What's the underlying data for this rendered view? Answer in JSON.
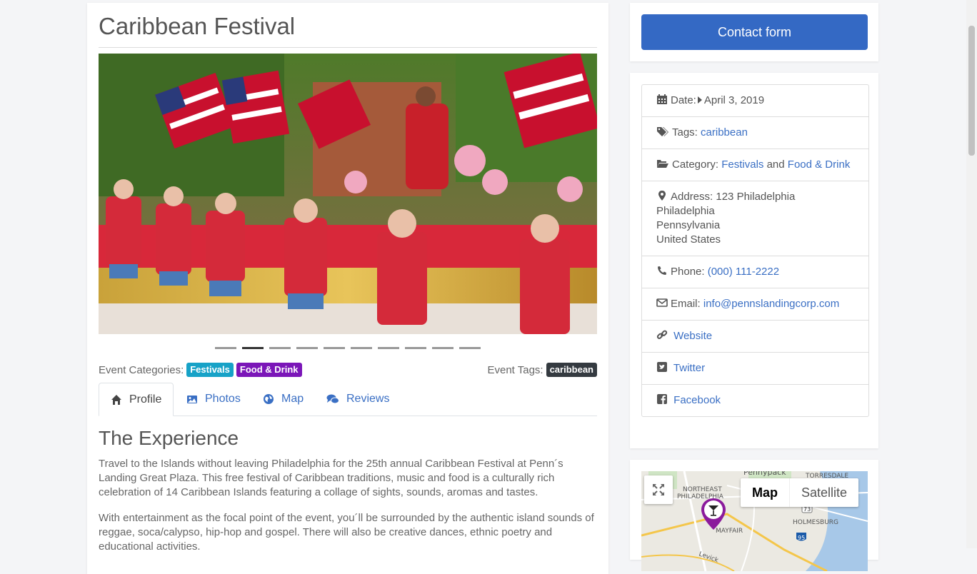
{
  "page": {
    "title": "Caribbean Festival"
  },
  "carousel": {
    "slide_count": 10,
    "active_index": 1
  },
  "meta": {
    "categories_label": "Event Categories:",
    "categories": [
      {
        "label": "Festivals",
        "color": "#17a2c7"
      },
      {
        "label": "Food & Drink",
        "color": "#7b16b8"
      }
    ],
    "tags_label": "Event Tags:",
    "tags": [
      {
        "label": "caribbean",
        "color": "#343a40"
      }
    ]
  },
  "tabs": [
    {
      "label": "Profile",
      "icon": "home-icon",
      "active": true
    },
    {
      "label": "Photos",
      "icon": "image-icon",
      "active": false
    },
    {
      "label": "Map",
      "icon": "globe-icon",
      "active": false
    },
    {
      "label": "Reviews",
      "icon": "comments-icon",
      "active": false
    }
  ],
  "content": {
    "heading": "The Experience",
    "paragraph1": "Travel to the Islands without leaving Philadelphia for the 25th annual Caribbean Festival at Penn´s Landing Great Plaza. This free festival of Caribbean traditions, music and food is a culturally rich celebration of 14 Caribbean Islands featuring a collage of sights, sounds, aromas and tastes.",
    "paragraph2": "With entertainment as the focal point of the event, you´ll be surrounded by the authentic island sounds of reggae, soca/calypso, hip-hop and gospel. There will also be creative dances, ethnic poetry and educational activities."
  },
  "sidebar": {
    "contact_button": "Contact form",
    "date_label": "Date:",
    "date_value": "April 3, 2019",
    "tags_label": "Tags:",
    "tags_value": "caribbean",
    "category_label": "Category:",
    "category_1": "Festivals",
    "category_and": "and",
    "category_2": "Food & Drink",
    "address_label": "Address:",
    "address_line1": "123 Philadelphia",
    "address_line2": "Philadelphia",
    "address_line3": "Pennsylvania",
    "address_line4": "United States",
    "phone_label": "Phone:",
    "phone_value": "(000) 111-2222",
    "email_label": "Email:",
    "email_value": "info@pennslandingcorp.com",
    "website_label": "Website",
    "twitter_label": "Twitter",
    "facebook_label": "Facebook"
  },
  "map": {
    "map_button": "Map",
    "satellite_button": "Satellite",
    "labels": {
      "pennypack": "Pennypack",
      "torresdale": "TORRESDALE",
      "northeast": "NORTHEAST",
      "philadelphia": "PHILADELPHIA",
      "holmesburg": "HOLMESBURG",
      "mayfair": "MAYFAIR",
      "levick": "Levick",
      "route73": "73",
      "route95": "95"
    }
  },
  "colors": {
    "primary": "#3469c4",
    "link": "#3a6fc4",
    "pin": "#8b1a9c"
  }
}
